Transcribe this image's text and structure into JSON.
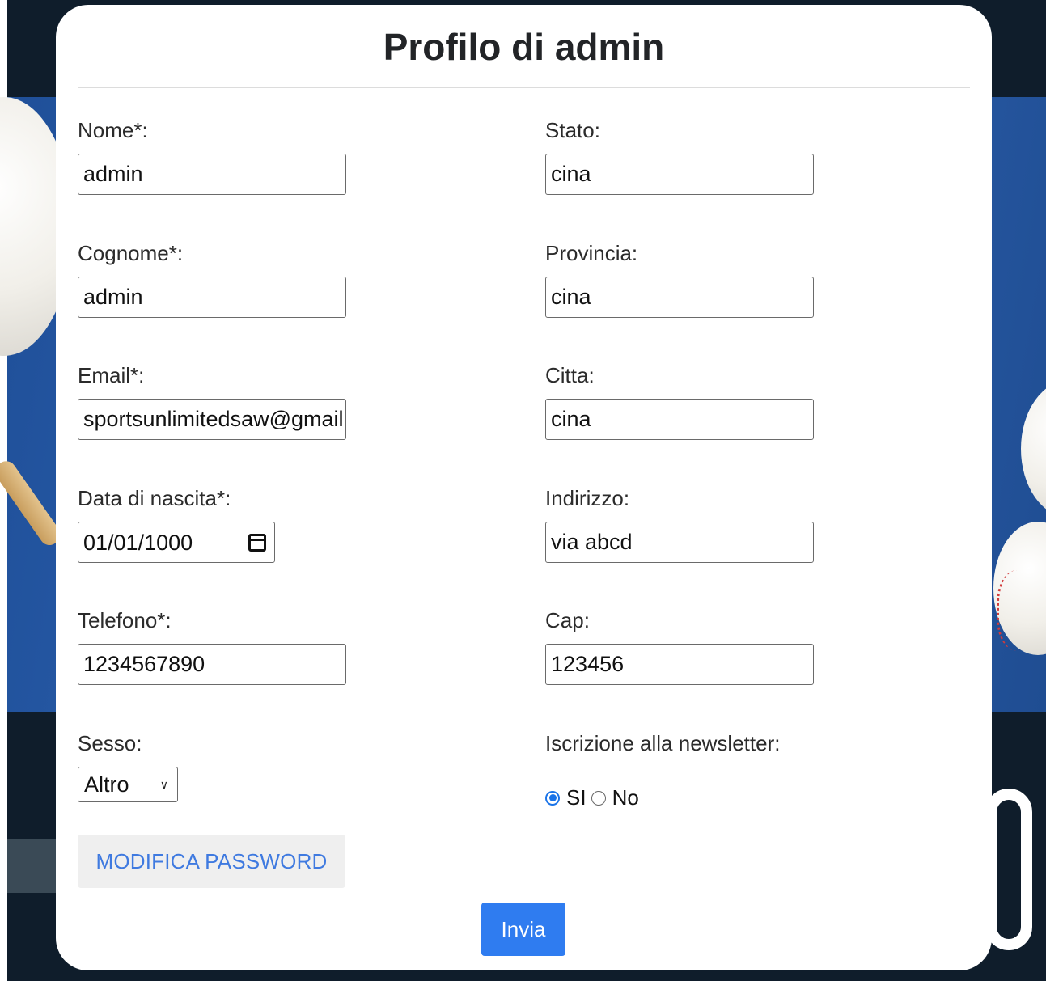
{
  "page": {
    "title": "Profilo di admin"
  },
  "left_fields": [
    {
      "label": "Nome*:",
      "value": "admin"
    },
    {
      "label": "Cognome*:",
      "value": "admin"
    },
    {
      "label": "Email*:",
      "value": "sportsunlimitedsaw@gmail.com"
    },
    {
      "label": "Data di nascita*:",
      "value": "01/01/1000"
    },
    {
      "label": "Telefono*:",
      "value": "1234567890"
    },
    {
      "label": "Sesso:",
      "value": "Altro"
    }
  ],
  "right_fields": [
    {
      "label": "Stato:",
      "value": "cina"
    },
    {
      "label": "Provincia:",
      "value": "cina"
    },
    {
      "label": "Citta:",
      "value": "cina"
    },
    {
      "label": "Indirizzo:",
      "value": "via abcd"
    },
    {
      "label": "Cap:",
      "value": "123456"
    }
  ],
  "newsletter": {
    "label": "Iscrizione alla newsletter:",
    "options": [
      {
        "label": "SI",
        "checked": true
      },
      {
        "label": "No",
        "checked": false
      }
    ]
  },
  "buttons": {
    "change_password": "MODIFICA PASSWORD",
    "submit": "Invia"
  },
  "icons": {
    "date_picker": "calendar-icon",
    "select_arrow": "chevron-down-icon"
  },
  "colors": {
    "accent": "#2f7cf0",
    "link": "#3f7ae0",
    "radio": "#1a73e8"
  }
}
